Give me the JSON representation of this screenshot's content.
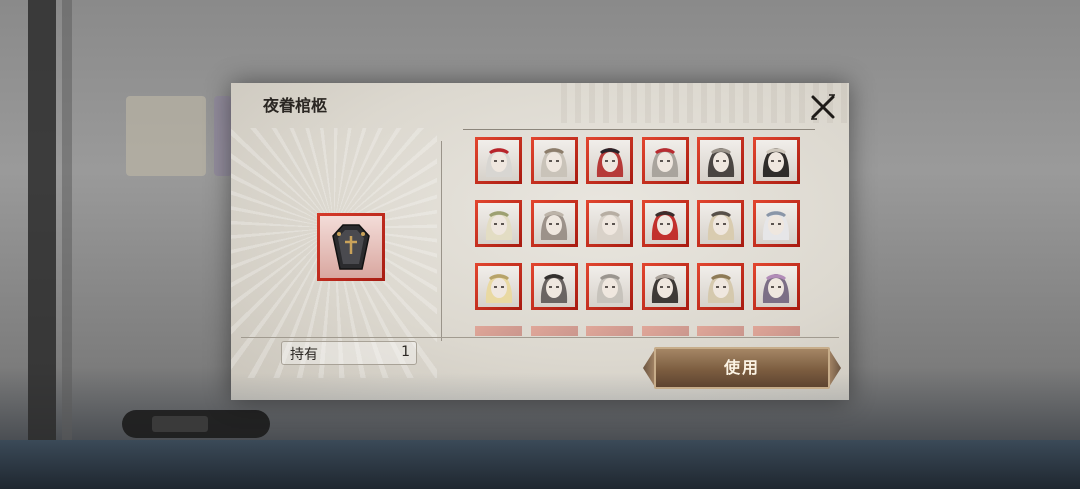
{
  "dialog": {
    "title": "夜眷棺柩",
    "close_icon": "close-x-icon",
    "item_icon": "coffin-icon",
    "own_label": "持有",
    "own_count": "1",
    "use_label": "使用"
  },
  "portraits": {
    "rows": [
      [
        {
          "name": "portrait-1",
          "hair": "#d8d6d2",
          "accent": "#b8242a"
        },
        {
          "name": "portrait-2",
          "hair": "#c9c3b9",
          "accent": "#8c7d6b"
        },
        {
          "name": "portrait-3",
          "hair": "#b63a38",
          "accent": "#2a2228"
        },
        {
          "name": "portrait-4",
          "hair": "#a9a49d",
          "accent": "#b82b30"
        },
        {
          "name": "portrait-5",
          "hair": "#4a4542",
          "accent": "#9b948b"
        },
        {
          "name": "portrait-6",
          "hair": "#2f2c2a",
          "accent": "#cfc8bd"
        }
      ],
      [
        {
          "name": "portrait-7",
          "hair": "#e3ddc4",
          "accent": "#9da071"
        },
        {
          "name": "portrait-8",
          "hair": "#9c928a",
          "accent": "#bdb4a9"
        },
        {
          "name": "portrait-9",
          "hair": "#d9d2c9",
          "accent": "#b7aea3"
        },
        {
          "name": "portrait-10",
          "hair": "#c2302d",
          "accent": "#3b2d2c"
        },
        {
          "name": "portrait-11",
          "hair": "#d9ccb0",
          "accent": "#57504a"
        },
        {
          "name": "portrait-12",
          "hair": "#e6e6e8",
          "accent": "#8a96a8"
        }
      ],
      [
        {
          "name": "portrait-13",
          "hair": "#e9d9a2",
          "accent": "#b7a36a"
        },
        {
          "name": "portrait-14",
          "hair": "#6a6462",
          "accent": "#33302e"
        },
        {
          "name": "portrait-15",
          "hair": "#c7c3bc",
          "accent": "#9a958f"
        },
        {
          "name": "portrait-16",
          "hair": "#3e3a37",
          "accent": "#aaa29a"
        },
        {
          "name": "portrait-17",
          "hair": "#d5c9ae",
          "accent": "#8d7a56"
        },
        {
          "name": "portrait-18",
          "hair": "#7c6f86",
          "accent": "#b28cb8"
        }
      ]
    ]
  },
  "colors": {
    "frame_red": "#d63a2a",
    "button_brown": "#7c5d40"
  }
}
